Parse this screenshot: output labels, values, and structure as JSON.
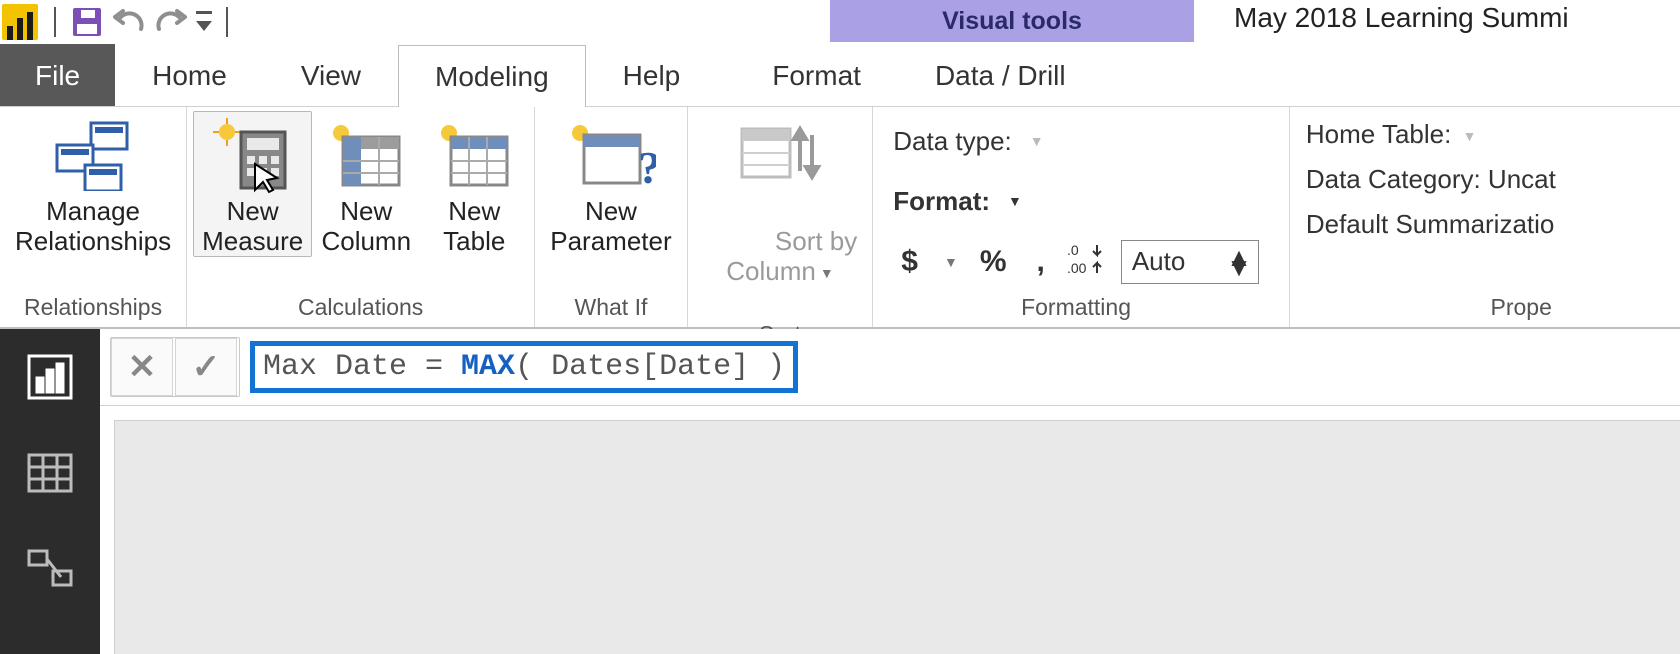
{
  "qat": {
    "title_context": "Visual tools",
    "doc_title": "May 2018 Learning Summi"
  },
  "menu": {
    "file": "File",
    "home": "Home",
    "view": "View",
    "modeling": "Modeling",
    "help": "Help",
    "format": "Format",
    "datadrill": "Data / Drill"
  },
  "ribbon": {
    "relationships": {
      "group": "Relationships",
      "manage": "Manage\nRelationships"
    },
    "calculations": {
      "group": "Calculations",
      "new_measure": "New\nMeasure",
      "new_column": "New\nColumn",
      "new_table": "New\nTable"
    },
    "whatif": {
      "group": "What If",
      "new_parameter": "New\nParameter"
    },
    "sort": {
      "group": "Sort",
      "sort_by": "Sort by\nColumn"
    },
    "formatting": {
      "group": "Formatting",
      "data_type": "Data type:",
      "format": "Format:",
      "currency": "$",
      "percent": "%",
      "thousand": ",",
      "decimals": ".00",
      "auto": "Auto"
    },
    "properties": {
      "group": "Prope",
      "home_table": "Home Table:",
      "data_category": "Data Category: Uncat",
      "default_sum": "Default Summarizatio"
    }
  },
  "formula": {
    "prefix": "Max Date = ",
    "func": "MAX",
    "args": "( Dates[Date] )"
  }
}
